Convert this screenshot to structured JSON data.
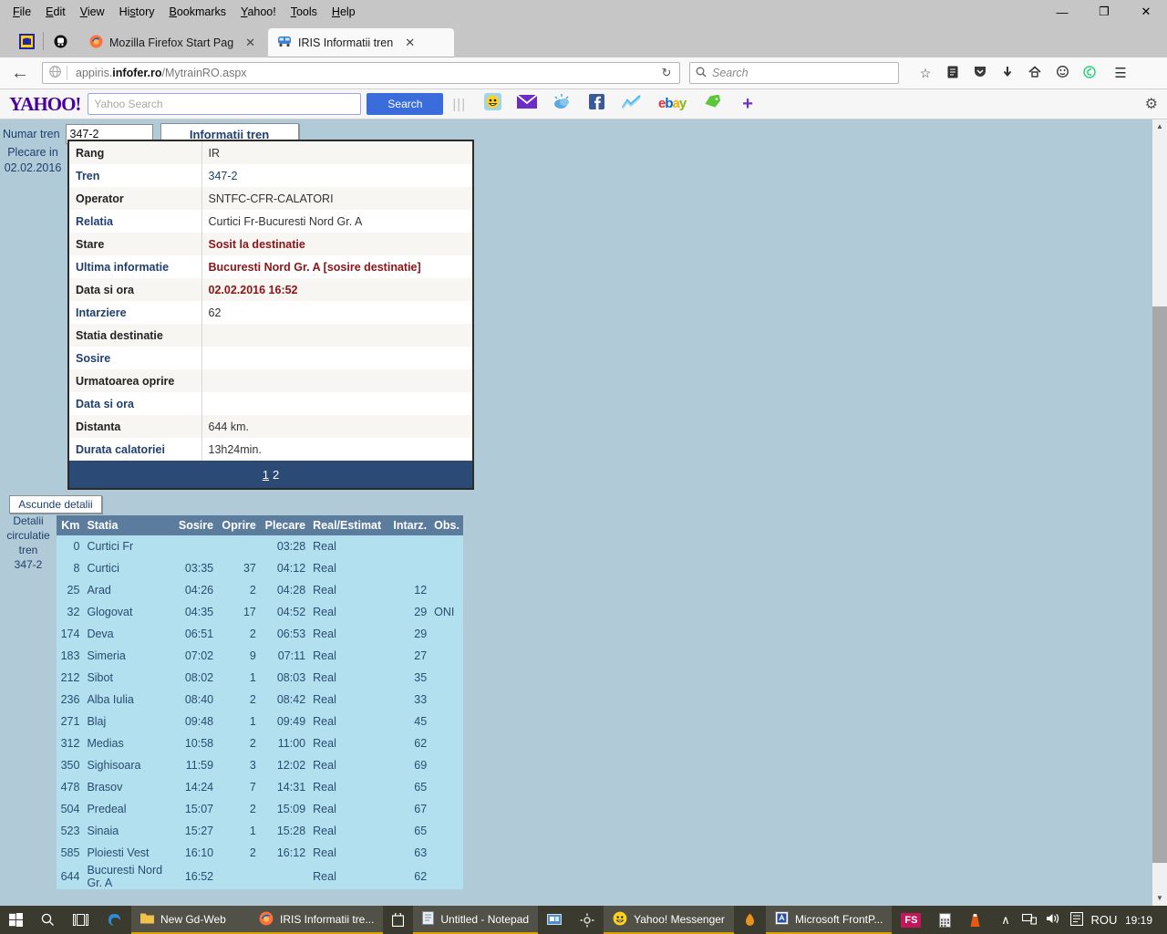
{
  "window": {
    "menus": [
      "File",
      "Edit",
      "View",
      "History",
      "Bookmarks",
      "Yahoo!",
      "Tools",
      "Help"
    ],
    "minimize": "—",
    "maximize": "❐",
    "close": "✕"
  },
  "tabs": [
    {
      "title": "Mozilla Firefox Start Page",
      "icon": "firefox-icon",
      "active": false,
      "close": "✕"
    },
    {
      "title": "IRIS Informatii tren",
      "icon": "train-icon",
      "active": true,
      "close": "✕"
    }
  ],
  "newtab_label": "+",
  "nav": {
    "back_icon": "←",
    "globe_icon": "ᵒ",
    "url_prefix": "appiris.",
    "url_host": "infofer.ro",
    "url_path": "/MytrainRO.aspx",
    "reload_icon": "↻",
    "search_placeholder": "Search",
    "icons": [
      "star-icon",
      "reader-icon",
      "pocket-icon",
      "download-icon",
      "home-icon",
      "smiley-icon",
      "sync-icon"
    ],
    "menu_icon": "☰"
  },
  "yahoo": {
    "logo": "YAHOO!",
    "search_placeholder": "Yahoo Search",
    "search_button": "Search",
    "buttons": [
      "messenger-icon",
      "mail-icon",
      "weather-icon",
      "facebook-icon",
      "finance-icon",
      "ebay-icon",
      "deals-icon",
      "add-icon"
    ],
    "gear_icon": "⚙"
  },
  "page": {
    "numar_tren_label": "Numar tren",
    "numar_tren_value": "347-2",
    "informatii_button": "Informatii tren",
    "plecare_label": "Plecare in",
    "plecare_date": "02.02.2016",
    "ascunde_button": "Ascunde detalii",
    "detalii_label_lines": [
      "Detalii",
      "circulatie",
      "tren",
      "347-2"
    ],
    "info_rows": [
      {
        "key": "Rang",
        "value": "IR",
        "key_color": "dark",
        "value_color": "normal"
      },
      {
        "key": "Tren",
        "value": "347-2",
        "key_color": "blue",
        "value_color": "blue"
      },
      {
        "key": "Operator",
        "value": "SNTFC-CFR-CALATORI",
        "key_color": "dark",
        "value_color": "normal"
      },
      {
        "key": "Relatia",
        "value": "Curtici Fr-Bucuresti Nord Gr. A",
        "key_color": "blue",
        "value_color": "normal"
      },
      {
        "key": "Stare",
        "value": "Sosit la destinatie",
        "key_color": "dark",
        "value_color": "red"
      },
      {
        "key": "Ultima informatie",
        "value": "Bucuresti Nord Gr. A [sosire destinatie]",
        "key_color": "blue",
        "value_color": "red"
      },
      {
        "key": "Data si ora",
        "value": "02.02.2016 16:52",
        "key_color": "dark",
        "value_color": "red"
      },
      {
        "key": "Intarziere",
        "value": "62",
        "key_color": "blue",
        "value_color": "normal"
      },
      {
        "key": "Statia destinatie",
        "value": "",
        "key_color": "dark",
        "value_color": "normal"
      },
      {
        "key": "Sosire",
        "value": "",
        "key_color": "blue",
        "value_color": "normal"
      },
      {
        "key": "Urmatoarea oprire",
        "value": "",
        "key_color": "dark",
        "value_color": "normal"
      },
      {
        "key": "Data si ora",
        "value": "",
        "key_color": "blue",
        "value_color": "normal"
      },
      {
        "key": "Distanta",
        "value": "644 km.",
        "key_color": "dark",
        "value_color": "normal"
      },
      {
        "key": "Durata calatoriei",
        "value": "13h24min.",
        "key_color": "blue",
        "value_color": "normal"
      }
    ],
    "pager": {
      "page1": "1",
      "page2": "2",
      "active": "1"
    },
    "stations_headers": [
      "Km",
      "Statia",
      "Sosire",
      "Oprire",
      "Plecare",
      "Real/Estimat",
      "Intarz.",
      "Obs."
    ],
    "stations": [
      {
        "km": "0",
        "statia": "Curtici Fr",
        "sosire": "",
        "oprire": "",
        "plecare": "03:28",
        "real": "Real",
        "intarz": "",
        "obs": ""
      },
      {
        "km": "8",
        "statia": "Curtici",
        "sosire": "03:35",
        "oprire": "37",
        "plecare": "04:12",
        "real": "Real",
        "intarz": "",
        "obs": ""
      },
      {
        "km": "25",
        "statia": "Arad",
        "sosire": "04:26",
        "oprire": "2",
        "plecare": "04:28",
        "real": "Real",
        "intarz": "12",
        "obs": ""
      },
      {
        "km": "32",
        "statia": "Glogovat",
        "sosire": "04:35",
        "oprire": "17",
        "plecare": "04:52",
        "real": "Real",
        "intarz": "29",
        "obs": "ONI"
      },
      {
        "km": "174",
        "statia": "Deva",
        "sosire": "06:51",
        "oprire": "2",
        "plecare": "06:53",
        "real": "Real",
        "intarz": "29",
        "obs": ""
      },
      {
        "km": "183",
        "statia": "Simeria",
        "sosire": "07:02",
        "oprire": "9",
        "plecare": "07:11",
        "real": "Real",
        "intarz": "27",
        "obs": ""
      },
      {
        "km": "212",
        "statia": "Sibot",
        "sosire": "08:02",
        "oprire": "1",
        "plecare": "08:03",
        "real": "Real",
        "intarz": "35",
        "obs": ""
      },
      {
        "km": "236",
        "statia": "Alba Iulia",
        "sosire": "08:40",
        "oprire": "2",
        "plecare": "08:42",
        "real": "Real",
        "intarz": "33",
        "obs": ""
      },
      {
        "km": "271",
        "statia": "Blaj",
        "sosire": "09:48",
        "oprire": "1",
        "plecare": "09:49",
        "real": "Real",
        "intarz": "45",
        "obs": ""
      },
      {
        "km": "312",
        "statia": "Medias",
        "sosire": "10:58",
        "oprire": "2",
        "plecare": "11:00",
        "real": "Real",
        "intarz": "62",
        "obs": ""
      },
      {
        "km": "350",
        "statia": "Sighisoara",
        "sosire": "11:59",
        "oprire": "3",
        "plecare": "12:02",
        "real": "Real",
        "intarz": "69",
        "obs": ""
      },
      {
        "km": "478",
        "statia": "Brasov",
        "sosire": "14:24",
        "oprire": "7",
        "plecare": "14:31",
        "real": "Real",
        "intarz": "65",
        "obs": ""
      },
      {
        "km": "504",
        "statia": "Predeal",
        "sosire": "15:07",
        "oprire": "2",
        "plecare": "15:09",
        "real": "Real",
        "intarz": "67",
        "obs": ""
      },
      {
        "km": "523",
        "statia": "Sinaia",
        "sosire": "15:27",
        "oprire": "1",
        "plecare": "15:28",
        "real": "Real",
        "intarz": "65",
        "obs": ""
      },
      {
        "km": "585",
        "statia": "Ploiesti Vest",
        "sosire": "16:10",
        "oprire": "2",
        "plecare": "16:12",
        "real": "Real",
        "intarz": "63",
        "obs": ""
      },
      {
        "km": "644",
        "statia": "Bucuresti Nord Gr. A",
        "sosire": "16:52",
        "oprire": "",
        "plecare": "",
        "real": "Real",
        "intarz": "62",
        "obs": ""
      }
    ]
  },
  "taskbar": {
    "start_icon": "windows-icon",
    "search_icon": "⚲",
    "taskview_icon": "❐",
    "items": [
      {
        "label": "",
        "icon": "edge-icon",
        "active": false
      },
      {
        "label": "New Gd-Web",
        "icon": "folder-icon",
        "active": true
      },
      {
        "label": "IRIS Informatii tre...",
        "icon": "firefox-icon",
        "active": true
      },
      {
        "label": "",
        "icon": "store-icon",
        "active": false
      },
      {
        "label": "Untitled - Notepad",
        "icon": "notepad-icon",
        "active": true
      },
      {
        "label": "",
        "icon": "remote-icon",
        "active": false
      },
      {
        "label": "",
        "icon": "settings-icon",
        "active": false
      },
      {
        "label": "Yahoo! Messenger",
        "icon": "messenger-icon",
        "active": true
      },
      {
        "label": "",
        "icon": "flame-icon",
        "active": false
      },
      {
        "label": "Microsoft FrontP...",
        "icon": "frontpage-icon",
        "active": true
      },
      {
        "label": "FS",
        "icon": "fs-icon",
        "active": false
      },
      {
        "label": "",
        "icon": "calculator-icon",
        "active": false
      },
      {
        "label": "",
        "icon": "vlc-icon",
        "active": false
      }
    ],
    "tray": [
      "∧",
      "network-icon",
      "volume-icon",
      "notification-icon"
    ],
    "language": "ROU",
    "clock": "19:19"
  },
  "colors": {
    "page_bg": "#b1cad7",
    "accent_dark_blue": "#2c4a76",
    "table_header": "#5c7c9e",
    "table_row": "#b2e0ee",
    "status_red": "#8a1418",
    "link_blue": "#1f3f6e"
  }
}
